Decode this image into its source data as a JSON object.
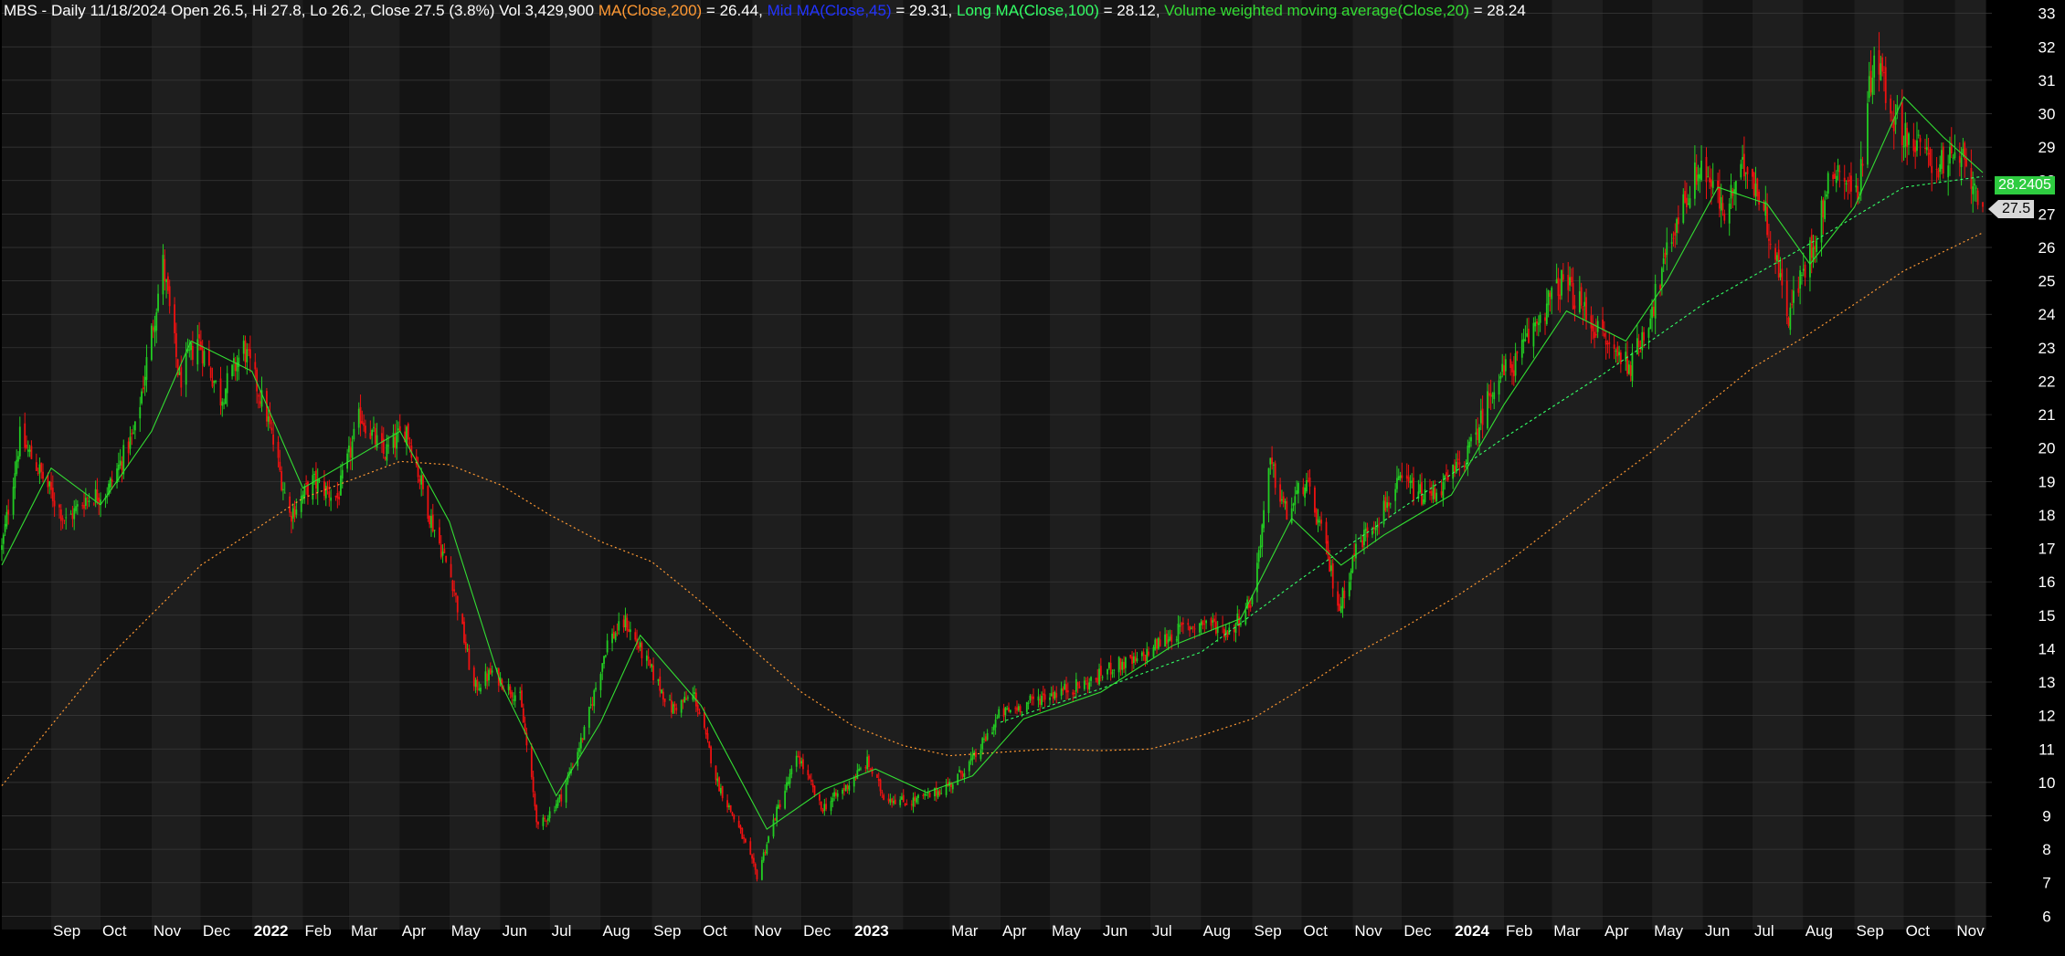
{
  "header": {
    "symbol_line": "MBS - Daily 11/18/2024 Open 26.5, Hi 27.8, Lo 26.2, Close 27.5 (3.8%) Vol 3,429,900",
    "ma200_label": "MA(Close,200)",
    "ma200_value": " = 26.44, ",
    "mid_ma_label": "Mid MA(Close,45)",
    "mid_ma_value": " = 29.31, ",
    "long_ma_label": "Long MA(Close,100)",
    "long_ma_value": " = 28.12, ",
    "vwma_label": "Volume weighted moving average(Close,20)",
    "vwma_value": " = 28.24"
  },
  "price_tags": {
    "vwma": "28.2405",
    "close": "27.5"
  },
  "colors": {
    "background": "#000000",
    "band_dark": "#141414",
    "band_light": "#1e1e1e",
    "grid": "#3a3a3a",
    "up_candle": "#22cc22",
    "down_candle": "#ee1111",
    "ma200": "#ff9933",
    "mid_ma": "#2233ff",
    "long_ma": "#33ff66",
    "vwma": "#33dd33",
    "axis_text": "#ffffff"
  },
  "chart_data": {
    "type": "line",
    "title": "MBS - Daily",
    "ylim": [
      5.6,
      33.4
    ],
    "y_ticks": [
      6,
      7,
      8,
      9,
      10,
      11,
      12,
      13,
      14,
      15,
      16,
      17,
      18,
      19,
      20,
      21,
      22,
      23,
      24,
      25,
      26,
      27,
      28,
      29,
      30,
      31,
      32,
      33
    ],
    "x_tick_labels": [
      "Sep",
      "Oct",
      "Nov",
      "Dec",
      "2022",
      "Feb",
      "Mar",
      "Apr",
      "May",
      "Jun",
      "Jul",
      "Aug",
      "Sep",
      "Oct",
      "Nov",
      "Dec",
      "2023",
      "Mar",
      "Apr",
      "May",
      "Jun",
      "Jul",
      "Aug",
      "Sep",
      "Oct",
      "Nov",
      "Dec",
      "2024",
      "Feb",
      "Mar",
      "Apr",
      "May",
      "Jun",
      "Jul",
      "Aug",
      "Sep",
      "Oct",
      "Nov"
    ],
    "x_start": "2021-08-02",
    "x_end": "2024-11-18",
    "close_path": [
      {
        "date": "2021-08-02",
        "close": 17.0
      },
      {
        "date": "2021-08-13",
        "close": 20.3
      },
      {
        "date": "2021-08-24",
        "close": 19.4
      },
      {
        "date": "2021-09-10",
        "close": 17.8
      },
      {
        "date": "2021-09-22",
        "close": 18.5
      },
      {
        "date": "2021-10-05",
        "close": 18.7
      },
      {
        "date": "2021-10-22",
        "close": 20.5
      },
      {
        "date": "2021-11-08",
        "close": 25.5
      },
      {
        "date": "2021-11-18",
        "close": 22.0
      },
      {
        "date": "2021-11-29",
        "close": 23.3
      },
      {
        "date": "2021-12-13",
        "close": 21.5
      },
      {
        "date": "2021-12-27",
        "close": 23.0
      },
      {
        "date": "2022-01-10",
        "close": 21.0
      },
      {
        "date": "2022-01-24",
        "close": 18.0
      },
      {
        "date": "2022-02-07",
        "close": 19.0
      },
      {
        "date": "2022-02-22",
        "close": 18.5
      },
      {
        "date": "2022-03-08",
        "close": 21.0
      },
      {
        "date": "2022-03-22",
        "close": 19.8
      },
      {
        "date": "2022-04-05",
        "close": 20.6
      },
      {
        "date": "2022-04-19",
        "close": 18.0
      },
      {
        "date": "2022-05-03",
        "close": 16.0
      },
      {
        "date": "2022-05-16",
        "close": 12.8
      },
      {
        "date": "2022-05-27",
        "close": 13.3
      },
      {
        "date": "2022-06-13",
        "close": 12.5
      },
      {
        "date": "2022-06-24",
        "close": 8.6
      },
      {
        "date": "2022-07-08",
        "close": 9.6
      },
      {
        "date": "2022-07-22",
        "close": 11.5
      },
      {
        "date": "2022-08-05",
        "close": 14.2
      },
      {
        "date": "2022-08-16",
        "close": 14.8
      },
      {
        "date": "2022-08-30",
        "close": 13.5
      },
      {
        "date": "2022-09-13",
        "close": 12.2
      },
      {
        "date": "2022-09-27",
        "close": 12.6
      },
      {
        "date": "2022-10-11",
        "close": 10.0
      },
      {
        "date": "2022-10-25",
        "close": 8.5
      },
      {
        "date": "2022-11-04",
        "close": 7.2
      },
      {
        "date": "2022-11-15",
        "close": 9.0
      },
      {
        "date": "2022-11-29",
        "close": 10.8
      },
      {
        "date": "2022-12-13",
        "close": 9.2
      },
      {
        "date": "2022-12-27",
        "close": 9.8
      },
      {
        "date": "2023-01-10",
        "close": 10.6
      },
      {
        "date": "2023-01-20",
        "close": 9.6
      },
      {
        "date": "2023-02-03",
        "close": 9.4
      },
      {
        "date": "2023-02-17",
        "close": 9.6
      },
      {
        "date": "2023-03-03",
        "close": 10.0
      },
      {
        "date": "2023-03-17",
        "close": 10.8
      },
      {
        "date": "2023-03-31",
        "close": 12.0
      },
      {
        "date": "2023-04-14",
        "close": 12.3
      },
      {
        "date": "2023-04-28",
        "close": 12.6
      },
      {
        "date": "2023-05-12",
        "close": 12.8
      },
      {
        "date": "2023-05-26",
        "close": 13.0
      },
      {
        "date": "2023-06-09",
        "close": 13.5
      },
      {
        "date": "2023-06-23",
        "close": 13.6
      },
      {
        "date": "2023-07-07",
        "close": 14.2
      },
      {
        "date": "2023-07-21",
        "close": 14.6
      },
      {
        "date": "2023-08-04",
        "close": 14.8
      },
      {
        "date": "2023-08-18",
        "close": 14.5
      },
      {
        "date": "2023-09-01",
        "close": 15.5
      },
      {
        "date": "2023-09-12",
        "close": 19.5
      },
      {
        "date": "2023-09-22",
        "close": 18.0
      },
      {
        "date": "2023-10-03",
        "close": 19.0
      },
      {
        "date": "2023-10-13",
        "close": 17.5
      },
      {
        "date": "2023-10-24",
        "close": 15.2
      },
      {
        "date": "2023-11-03",
        "close": 17.0
      },
      {
        "date": "2023-11-17",
        "close": 18.0
      },
      {
        "date": "2023-12-01",
        "close": 19.0
      },
      {
        "date": "2023-12-15",
        "close": 18.5
      },
      {
        "date": "2023-12-29",
        "close": 19.0
      },
      {
        "date": "2024-01-12",
        "close": 20.0
      },
      {
        "date": "2024-01-26",
        "close": 22.0
      },
      {
        "date": "2024-02-09",
        "close": 22.6
      },
      {
        "date": "2024-02-23",
        "close": 24.0
      },
      {
        "date": "2024-03-08",
        "close": 25.0
      },
      {
        "date": "2024-03-22",
        "close": 24.0
      },
      {
        "date": "2024-04-05",
        "close": 23.0
      },
      {
        "date": "2024-04-19",
        "close": 22.5
      },
      {
        "date": "2024-05-03",
        "close": 24.5
      },
      {
        "date": "2024-05-17",
        "close": 27.0
      },
      {
        "date": "2024-05-31",
        "close": 28.5
      },
      {
        "date": "2024-06-14",
        "close": 27.0
      },
      {
        "date": "2024-06-28",
        "close": 28.6
      },
      {
        "date": "2024-07-09",
        "close": 27.0
      },
      {
        "date": "2024-07-23",
        "close": 24.0
      },
      {
        "date": "2024-08-06",
        "close": 26.0
      },
      {
        "date": "2024-08-20",
        "close": 28.5
      },
      {
        "date": "2024-09-03",
        "close": 27.5
      },
      {
        "date": "2024-09-13",
        "close": 32.0
      },
      {
        "date": "2024-09-24",
        "close": 30.0
      },
      {
        "date": "2024-10-08",
        "close": 29.0
      },
      {
        "date": "2024-10-22",
        "close": 28.5
      },
      {
        "date": "2024-11-05",
        "close": 28.6
      },
      {
        "date": "2024-11-18",
        "close": 27.5
      }
    ],
    "series": [
      {
        "name": "MA(Close,200)",
        "points": [
          {
            "date": "2021-08-02",
            "value": 9.9
          },
          {
            "date": "2021-10-01",
            "value": 13.5
          },
          {
            "date": "2021-12-01",
            "value": 16.5
          },
          {
            "date": "2022-02-01",
            "value": 18.5
          },
          {
            "date": "2022-04-01",
            "value": 19.6
          },
          {
            "date": "2022-05-01",
            "value": 19.5
          },
          {
            "date": "2022-06-01",
            "value": 18.9
          },
          {
            "date": "2022-07-01",
            "value": 18.0
          },
          {
            "date": "2022-08-01",
            "value": 17.2
          },
          {
            "date": "2022-09-01",
            "value": 16.6
          },
          {
            "date": "2022-10-01",
            "value": 15.4
          },
          {
            "date": "2022-11-01",
            "value": 14.0
          },
          {
            "date": "2022-12-01",
            "value": 12.7
          },
          {
            "date": "2023-01-01",
            "value": 11.7
          },
          {
            "date": "2023-02-01",
            "value": 11.1
          },
          {
            "date": "2023-03-01",
            "value": 10.8
          },
          {
            "date": "2023-04-01",
            "value": 10.9
          },
          {
            "date": "2023-05-01",
            "value": 11.0
          },
          {
            "date": "2023-06-01",
            "value": 10.95
          },
          {
            "date": "2023-07-01",
            "value": 11.0
          },
          {
            "date": "2023-08-01",
            "value": 11.4
          },
          {
            "date": "2023-09-01",
            "value": 11.9
          },
          {
            "date": "2023-10-01",
            "value": 12.8
          },
          {
            "date": "2023-11-01",
            "value": 13.8
          },
          {
            "date": "2023-12-01",
            "value": 14.6
          },
          {
            "date": "2024-01-01",
            "value": 15.5
          },
          {
            "date": "2024-02-01",
            "value": 16.5
          },
          {
            "date": "2024-03-01",
            "value": 17.6
          },
          {
            "date": "2024-04-01",
            "value": 18.8
          },
          {
            "date": "2024-05-01",
            "value": 19.9
          },
          {
            "date": "2024-06-01",
            "value": 21.2
          },
          {
            "date": "2024-07-01",
            "value": 22.4
          },
          {
            "date": "2024-08-01",
            "value": 23.3
          },
          {
            "date": "2024-09-01",
            "value": 24.3
          },
          {
            "date": "2024-10-01",
            "value": 25.3
          },
          {
            "date": "2024-11-18",
            "value": 26.44
          }
        ]
      },
      {
        "name": "Mid MA(Close,45)",
        "points": [
          {
            "date": "2023-04-01",
            "value": 11.8
          },
          {
            "date": "2023-06-01",
            "value": 12.8
          },
          {
            "date": "2023-08-01",
            "value": 13.9
          },
          {
            "date": "2023-10-01",
            "value": 16.1
          },
          {
            "date": "2023-12-01",
            "value": 18.2
          },
          {
            "date": "2024-02-01",
            "value": 20.3
          },
          {
            "date": "2024-04-01",
            "value": 22.2
          },
          {
            "date": "2024-06-01",
            "value": 24.3
          },
          {
            "date": "2024-08-01",
            "value": 26.0
          },
          {
            "date": "2024-10-01",
            "value": 27.8
          },
          {
            "date": "2024-11-18",
            "value": 28.12
          }
        ]
      },
      {
        "name": "Volume weighted moving average(Close,20)",
        "points": [
          {
            "date": "2021-08-02",
            "value": 16.5
          },
          {
            "date": "2021-09-01",
            "value": 19.4
          },
          {
            "date": "2021-10-01",
            "value": 18.3
          },
          {
            "date": "2021-11-01",
            "value": 20.5
          },
          {
            "date": "2021-11-25",
            "value": 23.2
          },
          {
            "date": "2022-01-01",
            "value": 22.3
          },
          {
            "date": "2022-02-01",
            "value": 18.8
          },
          {
            "date": "2022-03-01",
            "value": 19.6
          },
          {
            "date": "2022-04-01",
            "value": 20.5
          },
          {
            "date": "2022-05-01",
            "value": 17.8
          },
          {
            "date": "2022-06-01",
            "value": 13.0
          },
          {
            "date": "2022-07-05",
            "value": 9.6
          },
          {
            "date": "2022-08-01",
            "value": 11.8
          },
          {
            "date": "2022-08-25",
            "value": 14.4
          },
          {
            "date": "2022-10-01",
            "value": 12.3
          },
          {
            "date": "2022-11-10",
            "value": 8.6
          },
          {
            "date": "2022-12-15",
            "value": 9.8
          },
          {
            "date": "2023-01-15",
            "value": 10.4
          },
          {
            "date": "2023-02-15",
            "value": 9.7
          },
          {
            "date": "2023-03-15",
            "value": 10.2
          },
          {
            "date": "2023-04-15",
            "value": 11.9
          },
          {
            "date": "2023-06-01",
            "value": 12.7
          },
          {
            "date": "2023-07-15",
            "value": 14.1
          },
          {
            "date": "2023-08-25",
            "value": 14.9
          },
          {
            "date": "2023-09-25",
            "value": 17.9
          },
          {
            "date": "2023-10-25",
            "value": 16.5
          },
          {
            "date": "2023-11-20",
            "value": 17.4
          },
          {
            "date": "2023-12-31",
            "value": 18.6
          },
          {
            "date": "2024-02-01",
            "value": 21.3
          },
          {
            "date": "2024-03-10",
            "value": 24.1
          },
          {
            "date": "2024-04-15",
            "value": 23.2
          },
          {
            "date": "2024-05-10",
            "value": 25.0
          },
          {
            "date": "2024-06-10",
            "value": 27.8
          },
          {
            "date": "2024-07-10",
            "value": 27.3
          },
          {
            "date": "2024-08-05",
            "value": 25.5
          },
          {
            "date": "2024-09-01",
            "value": 27.2
          },
          {
            "date": "2024-10-01",
            "value": 30.5
          },
          {
            "date": "2024-10-25",
            "value": 29.3
          },
          {
            "date": "2024-11-18",
            "value": 28.24
          }
        ]
      }
    ]
  }
}
